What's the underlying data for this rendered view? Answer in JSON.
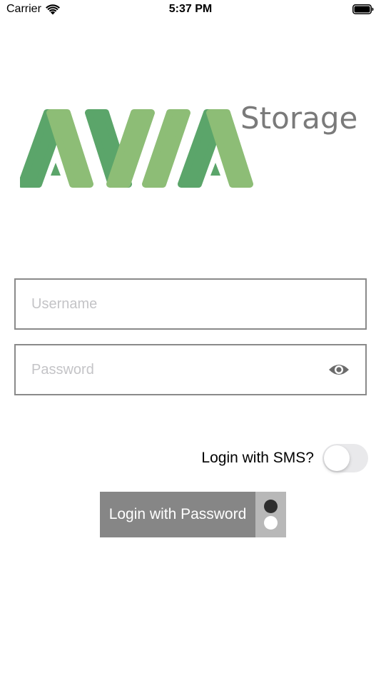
{
  "status_bar": {
    "carrier": "Carrier",
    "time": "5:37 PM",
    "wifi_icon": "wifi-icon",
    "battery_icon": "battery-icon"
  },
  "logo": {
    "brand": "AVIA",
    "product": "Storage",
    "colors": {
      "dark_green": "#5ba56a",
      "light_green": "#8dbd76",
      "text_gray": "#7a7a7a"
    }
  },
  "form": {
    "username": {
      "value": "",
      "placeholder": "Username"
    },
    "password": {
      "value": "",
      "placeholder": "Password",
      "toggle_icon": "eye-icon"
    },
    "sms": {
      "label": "Login with SMS?",
      "enabled": false
    },
    "login_button": {
      "label": "Login with Password",
      "background": "#868686"
    }
  }
}
